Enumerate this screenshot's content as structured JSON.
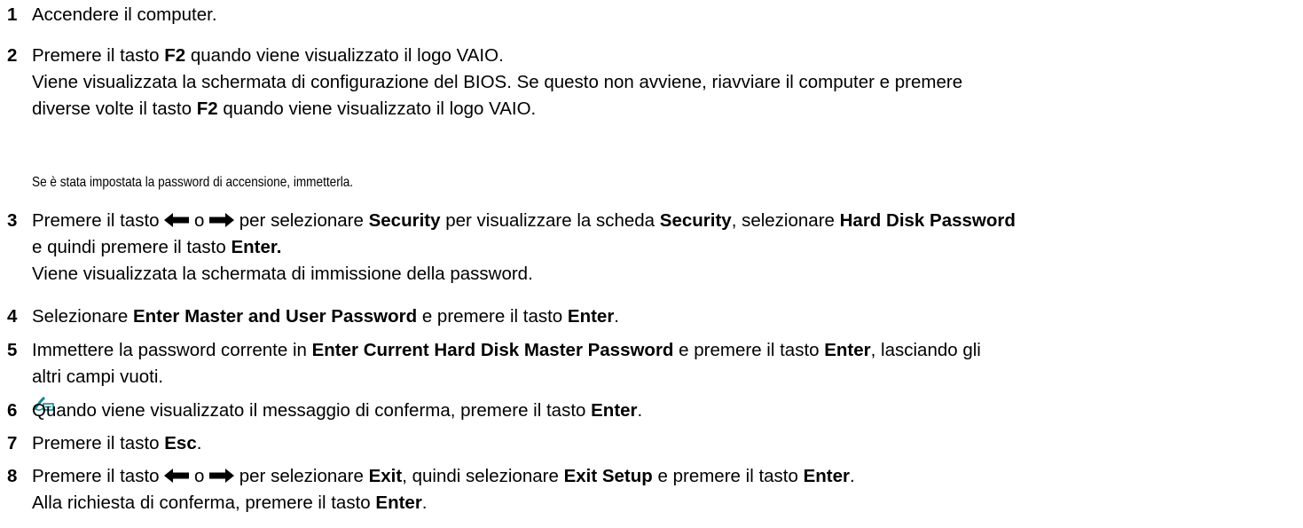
{
  "steps": [
    {
      "num": "1",
      "text": "Accendere il computer."
    },
    {
      "num": "2",
      "a": "Premere il tasto ",
      "b": "F2",
      "c": " quando viene visualizzato il logo VAIO.",
      "line2": "Viene visualizzata la schermata di configurazione del BIOS. Se questo non avviene, riavviare il computer e premere",
      "d": "diverse volte il tasto ",
      "e": "F2",
      "f": " quando viene visualizzato il logo VAIO."
    },
    {
      "num": "3",
      "a": "Premere il tasto ",
      "o": " o ",
      "c": " per selezionare ",
      "d": "Security",
      "e": " per visualizzare la scheda ",
      "f": "Security",
      "g": ", selezionare ",
      "h": "Hard Disk Password",
      "i": "e quindi premere il tasto ",
      "j": "Enter.",
      "line3": "Viene visualizzata la schermata di immissione della password."
    },
    {
      "num": "4",
      "a": "Selezionare ",
      "b": "Enter Master and User Password",
      "c": " e premere il tasto ",
      "d": "Enter",
      "e": "."
    },
    {
      "num": "5",
      "a": "Immettere la password corrente in ",
      "b": "Enter Current Hard Disk Master Password",
      "c": " e premere il tasto ",
      "d": "Enter",
      "e": ", lasciando gli",
      "f": "altri campi vuoti."
    },
    {
      "num": "6",
      "a": "Quando viene visualizzato il messaggio di conferma, premere il tasto ",
      "b": "Enter",
      "c": "."
    },
    {
      "num": "7",
      "a": "Premere il tasto ",
      "b": "Esc",
      "c": "."
    },
    {
      "num": "8",
      "a": "Premere il tasto ",
      "o": " o ",
      "c": " per selezionare ",
      "d": "Exit",
      "e": ", quindi selezionare ",
      "f": "Exit Setup",
      "g": " e premere il tasto ",
      "h": "Enter",
      "i": ".",
      "j": "Alla richiesta di conferma, premere il tasto ",
      "k": "Enter",
      "l": "."
    }
  ],
  "note": {
    "icon": "note-pen-icon",
    "text": "Se è stata impostata la password di accensione, immetterla."
  }
}
